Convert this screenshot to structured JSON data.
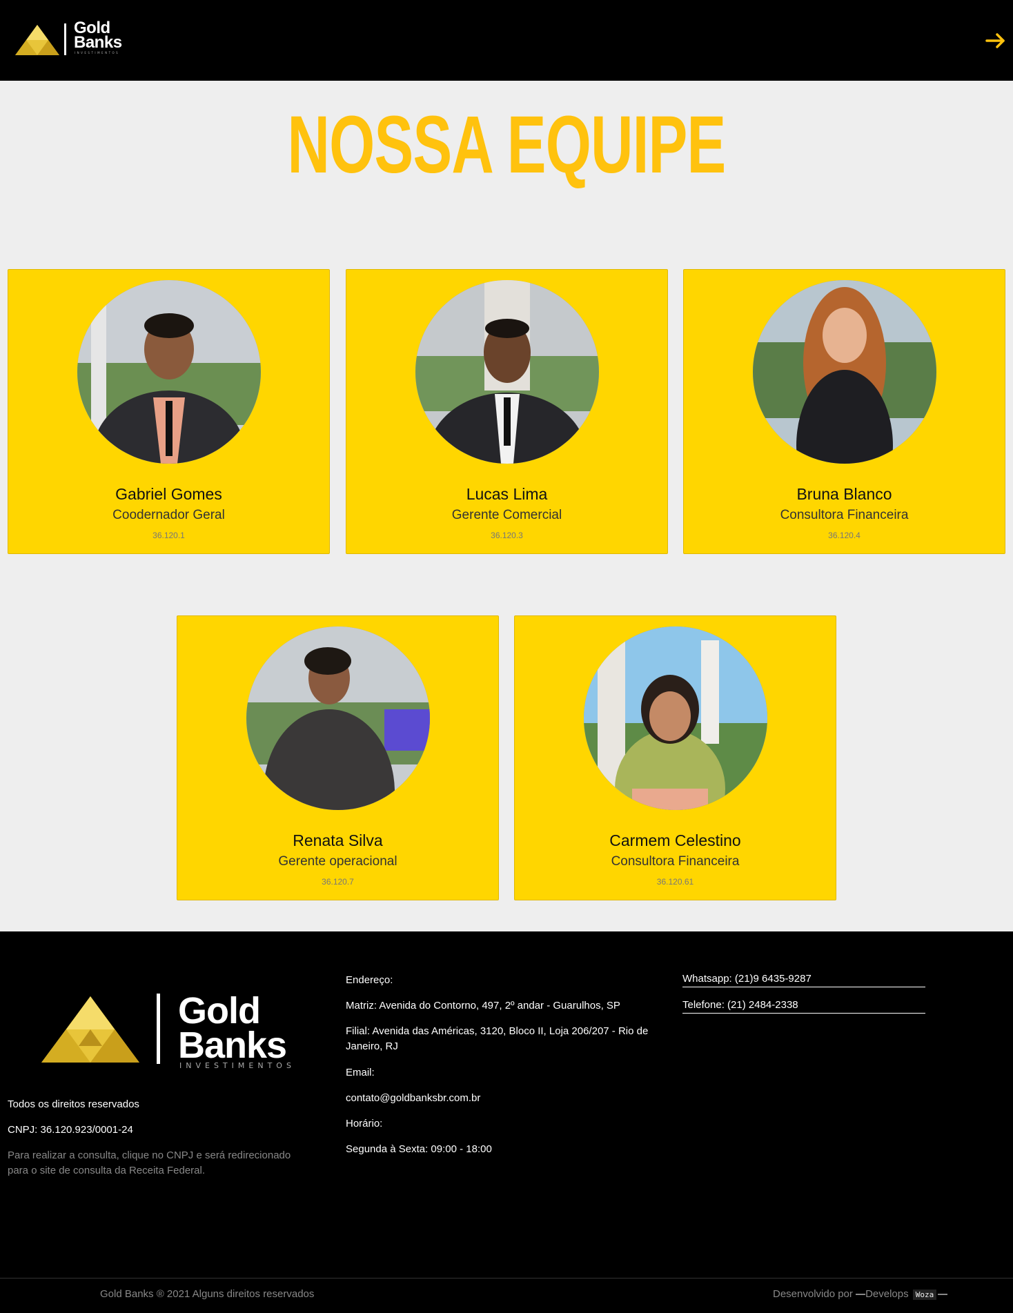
{
  "brand": {
    "name_line1": "Gold",
    "name_line2": "Banks",
    "tagline": "INVESTIMENTOS"
  },
  "header": {
    "nav_icon": "arrow-right-icon",
    "accent": "#ffc20e"
  },
  "page": {
    "title": "NOSSA EQUIPE"
  },
  "team": [
    {
      "name": "Gabriel Gomes",
      "role": "Coodernador Geral",
      "code": "36.120.1"
    },
    {
      "name": "Lucas Lima",
      "role": "Gerente Comercial",
      "code": "36.120.3"
    },
    {
      "name": "Bruna Blanco",
      "role": "Consultora Financeira",
      "code": "36.120.4"
    },
    {
      "name": "Renata Silva",
      "role": "Gerente operacional",
      "code": "36.120.7"
    },
    {
      "name": "Carmem Celestino",
      "role": "Consultora Financeira",
      "code": "36.120.61"
    }
  ],
  "footer": {
    "rights": "Todos os direitos reservados",
    "cnpj": "CNPJ: 36.120.923/0001-24",
    "cnpj_note_1": "Para realizar a consulta, clique no CNPJ e será redirecionado",
    "cnpj_note_2": "para o site de consulta da Receita Federal.",
    "address_label": "Endereço:",
    "address_matriz": "Matriz: Avenida do Contorno, 497, 2º andar - Guarulhos, SP",
    "address_filial_1": "Filial: Avenida das Américas, 3120, Bloco II, Loja 206/207 - Rio de",
    "address_filial_2": "Janeiro, RJ",
    "email_label": "Email:",
    "email": "contato@goldbanksbr.com.br",
    "hours_label": "Horário:",
    "hours": "Segunda à Sexta: 09:00 - 18:00",
    "whatsapp": "Whatsapp: (21)9 6435-9287",
    "phone": "Telefone: (21) 2484-2338",
    "copyright": "Gold Banks ® 2021 Alguns direitos reservados",
    "dev_prefix": "Desenvolvido por",
    "dev_name": "Develops",
    "dev_badge": "Woza"
  }
}
